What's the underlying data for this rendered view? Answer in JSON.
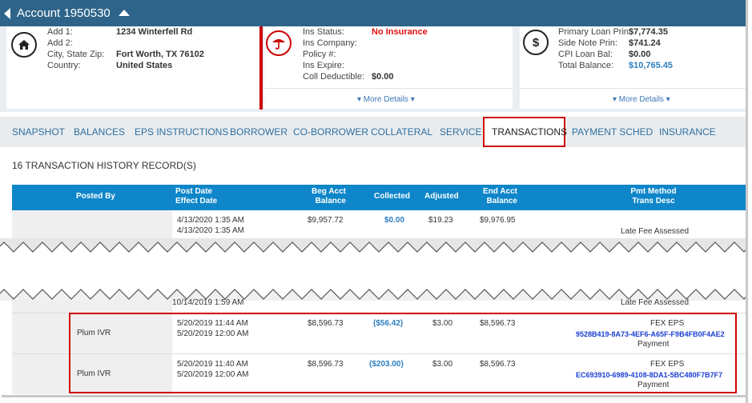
{
  "header": {
    "title": "Account 1950530"
  },
  "address": {
    "rows": [
      {
        "label": "Add 1:",
        "value": "1234 Winterfell Rd"
      },
      {
        "label": "Add 2:",
        "value": ""
      },
      {
        "label": "City, State Zip:",
        "value": "Fort Worth, TX 76102"
      },
      {
        "label": "Country:",
        "value": "United States"
      }
    ]
  },
  "insurance": {
    "rows": [
      {
        "label": "Ins Status:",
        "value": "No Insurance"
      },
      {
        "label": "Ins Company:",
        "value": ""
      },
      {
        "label": "Policy #:",
        "value": ""
      },
      {
        "label": "Ins Expire:",
        "value": ""
      },
      {
        "label": "Coll Deductible:",
        "value": "$0.00"
      }
    ],
    "more": "▾ More Details ▾"
  },
  "loan": {
    "rows": [
      {
        "label": "Primary Loan Prin:",
        "value": "$7,774.35"
      },
      {
        "label": "Side Note Prin:",
        "value": "$741.24"
      },
      {
        "label": "CPI Loan Bal:",
        "value": "$0.00"
      },
      {
        "label": "Total Balance:",
        "value": "$10,765.45"
      }
    ],
    "more": "▾ More Details ▾"
  },
  "tabs": [
    "SNAPSHOT",
    "BALANCES",
    "EPS INSTRUCTIONS",
    "BORROWER",
    "CO-BORROWER",
    "COLLATERAL",
    "SERVICE",
    "TRANSACTIONS",
    "PAYMENT SCHED",
    "INSURANCE"
  ],
  "records_label": "16 TRANSACTION HISTORY RECORD(S)",
  "table": {
    "headers": {
      "posted_by": "Posted By",
      "post_date": "Post Date",
      "effect_date": "Effect Date",
      "beg_acct": "Beg Acct",
      "beg_balance": "Balance",
      "collected": "Collected",
      "adjusted": "Adjusted",
      "end_acct": "End Acct",
      "end_balance": "Balance",
      "pmt_method": "Pmt Method",
      "trans_desc": "Trans Desc"
    },
    "row1": {
      "post_date": "4/13/2020 1:35 AM",
      "effect_date": "4/13/2020 1:35 AM",
      "beg_balance": "$9,957.72",
      "collected": "$0.00",
      "adjusted": "$19.23",
      "end_balance": "$9,976.95",
      "desc": "Late Fee Assessed"
    },
    "row_partial": {
      "effect_date": "10/14/2019 1:59 AM",
      "desc": "Late Fee Assessed"
    },
    "row2": {
      "posted_by": "Plum IVR",
      "post_date": "5/20/2019 11:44 AM",
      "effect_date": "5/20/2019 12:00 AM",
      "beg_balance": "$8,596.73",
      "collected": "($56.42)",
      "adjusted": "$3.00",
      "end_balance": "$8,596.73",
      "method": "FEX EPS",
      "trans_id": "9528B419-8A73-4EF6-A65F-F9B4FB0F4AE2",
      "desc": "Payment"
    },
    "row3": {
      "posted_by": "Plum IVR",
      "post_date": "5/20/2019 11:40 AM",
      "effect_date": "5/20/2019 12:00 AM",
      "beg_balance": "$8,596.73",
      "collected": "($203.00)",
      "adjusted": "$3.00",
      "end_balance": "$8,596.73",
      "method": "FEX EPS",
      "trans_id": "EC693910-6989-4108-8DA1-5BC480F7B7F7",
      "desc": "Payment"
    }
  },
  "colors": {
    "header": "#2e6489",
    "table_header": "#0e86c9",
    "highlight": "#d00000",
    "link": "#2d7fc1",
    "hash_link": "#1a3fd0"
  },
  "icons": [
    "back-arrow-icon",
    "collapse-caret-icon",
    "home-icon",
    "umbrella-icon",
    "dollar-icon"
  ]
}
